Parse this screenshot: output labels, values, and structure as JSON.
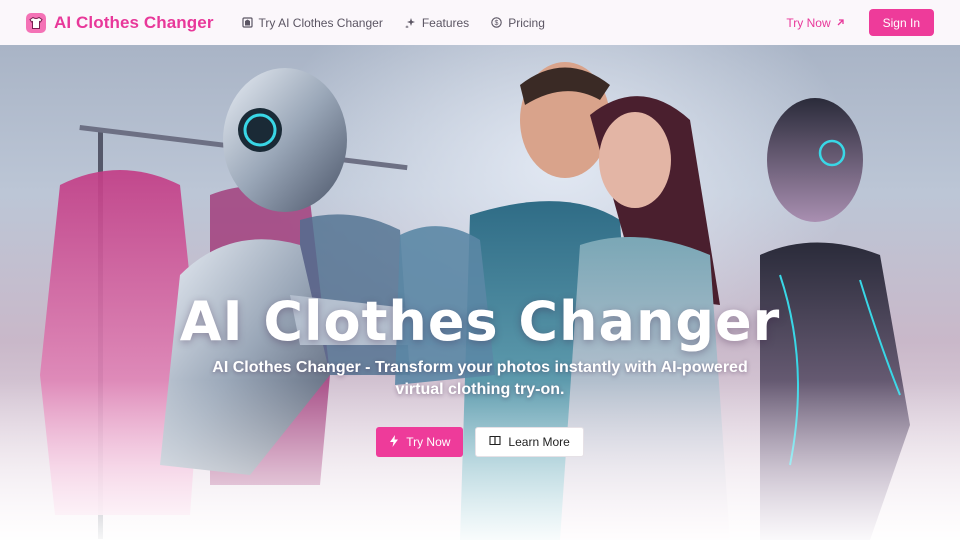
{
  "brand": {
    "title": "AI Clothes Changer",
    "logo_icon": "shirt-icon",
    "accent": "#ee3b9a"
  },
  "nav": {
    "items": [
      {
        "label": "Try AI Clothes Changer",
        "icon": "shirt-hanger-icon"
      },
      {
        "label": "Features",
        "icon": "sparkles-icon"
      },
      {
        "label": "Pricing",
        "icon": "dollar-circle-icon"
      }
    ]
  },
  "header": {
    "try_now_label": "Try Now",
    "sign_in_label": "Sign In"
  },
  "hero": {
    "title": "AI Clothes Changer",
    "subtitle": "AI Clothes Changer - Transform your photos instantly with AI-powered virtual clothing try-on.",
    "primary_cta": "Try Now",
    "secondary_cta": "Learn More"
  }
}
